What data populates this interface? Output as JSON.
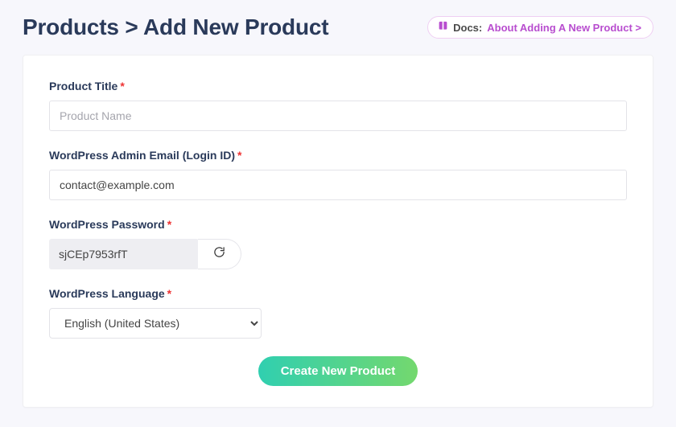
{
  "header": {
    "title": "Products > Add New Product",
    "docs_prefix": "Docs: ",
    "docs_link": "About Adding A New Product >"
  },
  "form": {
    "title_label": "Product Title",
    "title_required": "*",
    "title_placeholder": "Product Name",
    "title_value": "",
    "email_label": "WordPress Admin Email (Login ID)",
    "email_required": "*",
    "email_value": "contact@example.com",
    "password_label": "WordPress Password",
    "password_required": "*",
    "password_value": "sjCEp7953rfT",
    "language_label": "WordPress Language",
    "language_required": "*",
    "language_selected": "English (United States)",
    "submit_label": "Create New Product"
  },
  "icons": {
    "docs": "book-icon",
    "regenerate": "refresh-icon"
  }
}
